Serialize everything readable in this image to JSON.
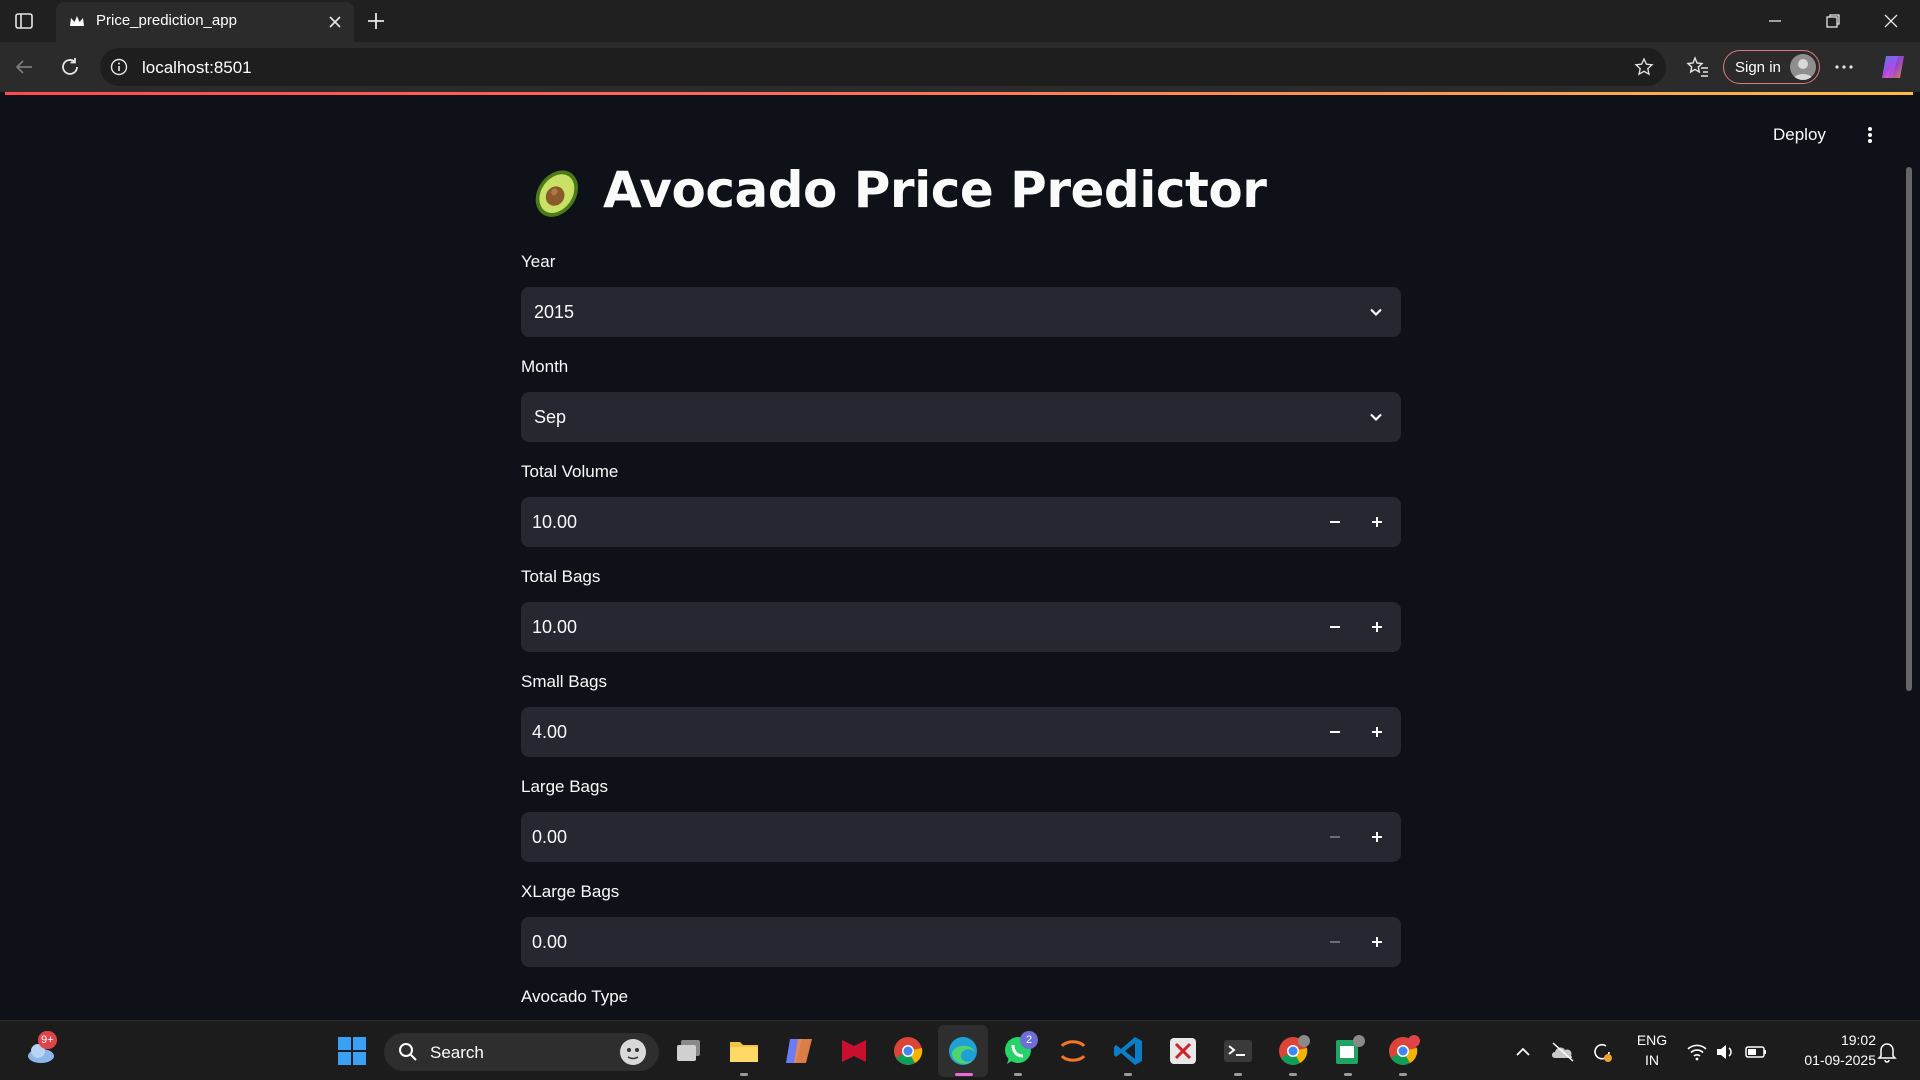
{
  "browser": {
    "tab_title": "Price_prediction_app",
    "url": "localhost:8501",
    "signin_label": "Sign in"
  },
  "app": {
    "deploy_label": "Deploy",
    "title": "Avocado Price Predictor",
    "fields": {
      "year": {
        "label": "Year",
        "value": "2015"
      },
      "month": {
        "label": "Month",
        "value": "Sep"
      },
      "total_volume": {
        "label": "Total Volume",
        "value": "10.00"
      },
      "total_bags": {
        "label": "Total Bags",
        "value": "10.00"
      },
      "small_bags": {
        "label": "Small Bags",
        "value": "4.00"
      },
      "large_bags": {
        "label": "Large Bags",
        "value": "0.00"
      },
      "xlarge_bags": {
        "label": "XLarge Bags",
        "value": "0.00"
      },
      "avocado_type": {
        "label": "Avocado Type"
      }
    }
  },
  "taskbar": {
    "weather_badge": "9+",
    "search_label": "Search",
    "whatsapp_badge": "2",
    "language": "ENG",
    "region": "IN",
    "time": "19:02",
    "date": "01-09-2025"
  },
  "colors": {
    "page_bg": "#0e1117",
    "input_bg": "#262730",
    "text": "#fafafa",
    "accent_red": "#ff4b4b"
  }
}
